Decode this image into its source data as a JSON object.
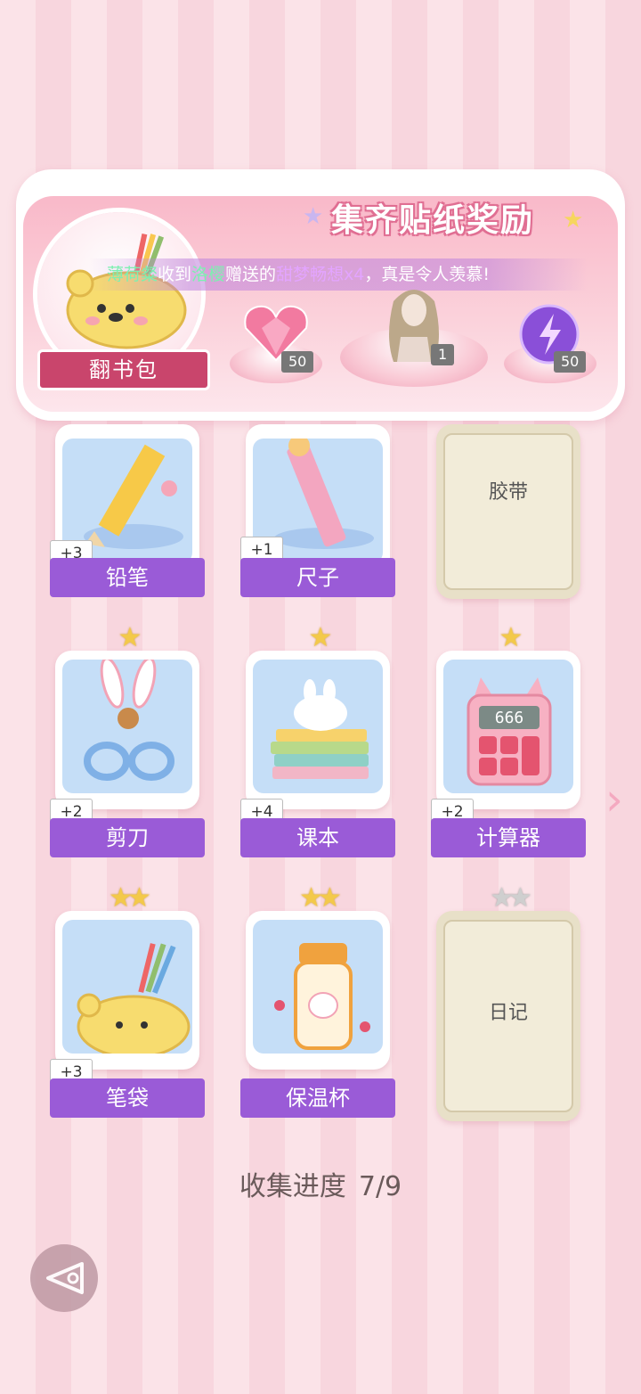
{
  "banner": {
    "title": "集齐贴纸奖励",
    "flip_label": "翻书包",
    "ticker": {
      "name1": "薄荷粲",
      "text1": "收到",
      "name2": "洛樱",
      "text2": "赠送的",
      "gift": "甜梦畅想x4",
      "text3": "，真是令人羡慕!"
    },
    "rewards": [
      {
        "icon": "pink-heart-gem",
        "count": "50"
      },
      {
        "icon": "hair-outfit",
        "count": "1"
      },
      {
        "icon": "purple-energy-orb",
        "count": "50"
      }
    ]
  },
  "stickers": [
    {
      "name": "铅笔",
      "plus": "+3",
      "stars": 1,
      "unlocked": true
    },
    {
      "name": "尺子",
      "plus": "+1",
      "stars": 1,
      "unlocked": true
    },
    {
      "name": "胶带",
      "plus": "",
      "stars": 1,
      "unlocked": false
    },
    {
      "name": "剪刀",
      "plus": "+2",
      "stars": 1,
      "unlocked": true
    },
    {
      "name": "课本",
      "plus": "+4",
      "stars": 1,
      "unlocked": true
    },
    {
      "name": "计算器",
      "plus": "+2",
      "stars": 1,
      "unlocked": true
    },
    {
      "name": "笔袋",
      "plus": "+3",
      "stars": 2,
      "unlocked": true
    },
    {
      "name": "保温杯",
      "plus": "",
      "stars": 2,
      "unlocked": true
    },
    {
      "name": "日记",
      "plus": "",
      "stars": 2,
      "unlocked": false
    }
  ],
  "calculator_display": "666",
  "progress": {
    "label": "收集进度",
    "value": "7/9"
  }
}
